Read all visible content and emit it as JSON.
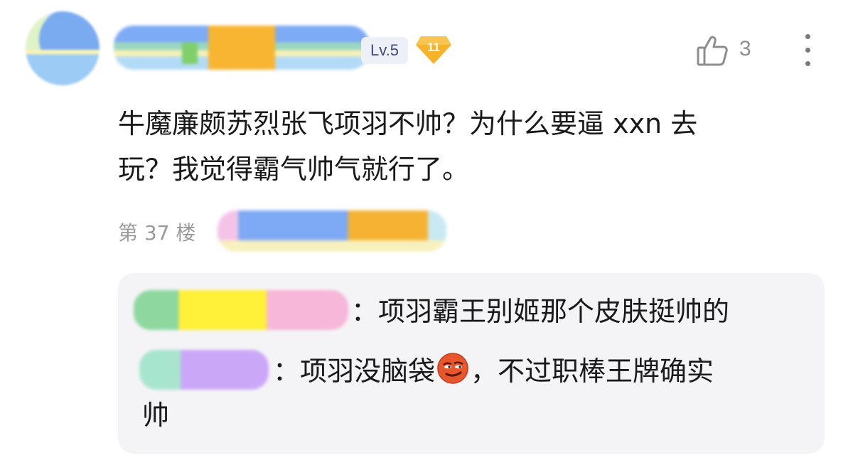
{
  "comment": {
    "level_badge": "Lv.5",
    "honor_badge": "11",
    "like_count": "3",
    "text": "牛魔廉颇苏烈张飞项羽不帅？为什么要逼 xxn 去\n玩？我觉得霸气帅气就行了。",
    "floor": "第 37 楼"
  },
  "replies": [
    {
      "text": "：项羽霸王别姬那个皮肤挺帅的"
    },
    {
      "text_before_emoji": "：项羽没脑袋",
      "emoji": "smirk-emoji",
      "text_after_emoji": "，不过职棒王牌确实",
      "text_wrap": "帅"
    }
  ],
  "icons": [
    "thumbs-up-icon",
    "more-vertical-icon",
    "honor-badge-icon",
    "smirk-emoji"
  ],
  "colors": {
    "level_badge_bg": "#eef0f8",
    "honor_badge": "#f6b329",
    "reply_box_bg": "#f4f4f6",
    "muted_text": "#9a9a9a"
  }
}
